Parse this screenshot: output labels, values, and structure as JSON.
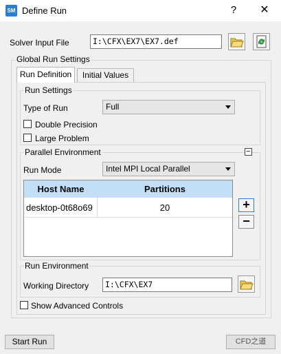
{
  "window": {
    "icon_text": "SM",
    "title": "Define Run",
    "help": "?",
    "close": "✕"
  },
  "solver": {
    "label": "Solver Input File",
    "value": "I:\\CFX\\EX7\\EX7.def"
  },
  "global": {
    "label": "Global Run Settings",
    "tabs": [
      "Run Definition",
      "Initial Values"
    ],
    "active_tab": "Run Definition"
  },
  "run_settings": {
    "label": "Run Settings",
    "type_label": "Type of Run",
    "type_value": "Full",
    "double_precision": {
      "label": "Double Precision",
      "checked": false
    },
    "large_problem": {
      "label": "Large Problem",
      "checked": false
    }
  },
  "parallel": {
    "label": "Parallel Environment",
    "collapse_glyph": "−",
    "mode_label": "Run Mode",
    "mode_value": "Intel MPI Local Parallel",
    "columns": [
      "Host Name",
      "Partitions"
    ],
    "rows": [
      {
        "host": "desktop-0t68o69",
        "partitions": "20"
      }
    ],
    "add_glyph": "+",
    "remove_glyph": "−"
  },
  "run_env": {
    "label": "Run Environment",
    "dir_label": "Working Directory",
    "dir_value": "I:\\CFX\\EX7"
  },
  "advanced": {
    "label": "Show Advanced Controls",
    "checked": false
  },
  "footer": {
    "start_label": "Start Run",
    "watermark": "CFD之道"
  }
}
